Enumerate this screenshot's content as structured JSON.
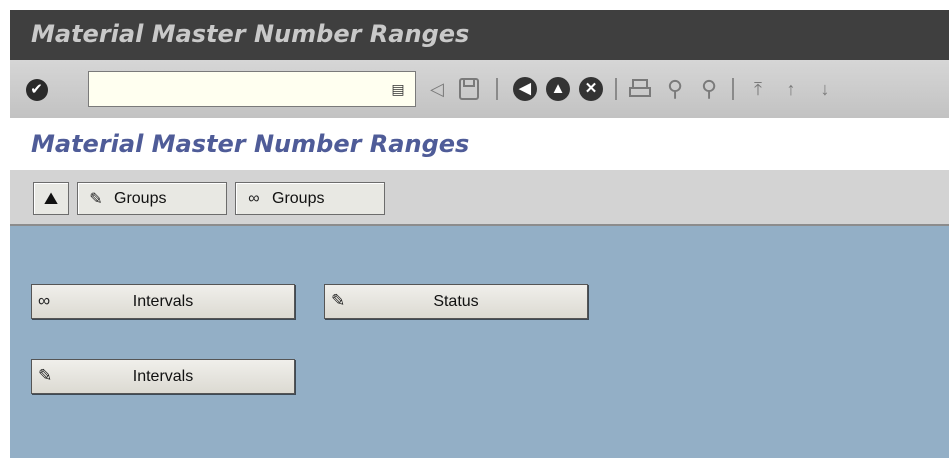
{
  "window": {
    "title": "Material Master Number Ranges"
  },
  "standard_toolbar": {
    "command_field": {
      "value": "",
      "placeholder": ""
    },
    "icons": [
      "enter-check-icon",
      "save-icon",
      "back-icon",
      "exit-icon",
      "cancel-icon",
      "print-icon",
      "find-icon",
      "find-next-icon",
      "first-page-icon",
      "previous-page-icon"
    ]
  },
  "app_title": "Material Master Number Ranges",
  "app_toolbar": {
    "buttons": [
      {
        "label": "",
        "icon": "organizational-object-icon"
      },
      {
        "label": "Groups",
        "icon": "pencil-icon"
      },
      {
        "label": "Groups",
        "icon": "glasses-icon"
      }
    ]
  },
  "main": {
    "buttons": [
      {
        "label": "Intervals",
        "icon": "glasses-icon"
      },
      {
        "label": "Status",
        "icon": "pencil-icon"
      },
      {
        "label": "Intervals",
        "icon": "pencil-icon"
      }
    ]
  },
  "colors": {
    "title_bar": "#3f3f3f",
    "app_title_text": "#4f5c98",
    "content_bg": "#93afc6"
  }
}
